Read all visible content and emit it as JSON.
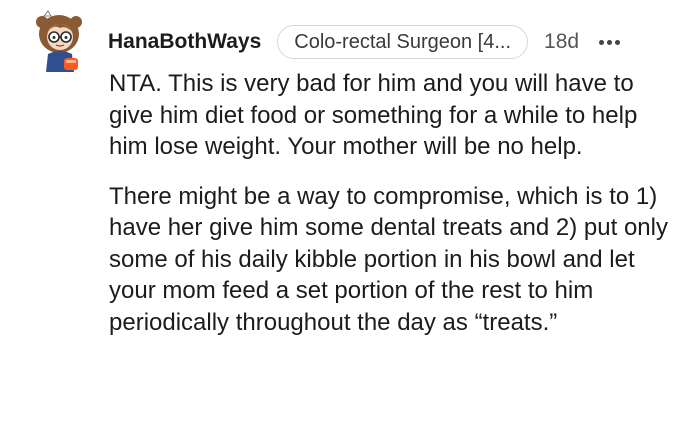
{
  "comment": {
    "username": "HanaBothWays",
    "flair": "Colo-rectal Surgeon [4...",
    "timestamp": "18d",
    "more_icon": "more-options-icon",
    "avatar_icon": "user-avatar",
    "paragraphs": [
      "NTA. This is very bad for him and you will have to give him diet food or something for a while to help him lose weight. Your mother will be no help.",
      "There might be a way to compromise, which is to 1) have her give him some dental treats and 2) put only some of his daily kibble portion in his bowl and let your mom feed a set portion of the rest to him periodically throughout the day as “treats.”"
    ]
  }
}
